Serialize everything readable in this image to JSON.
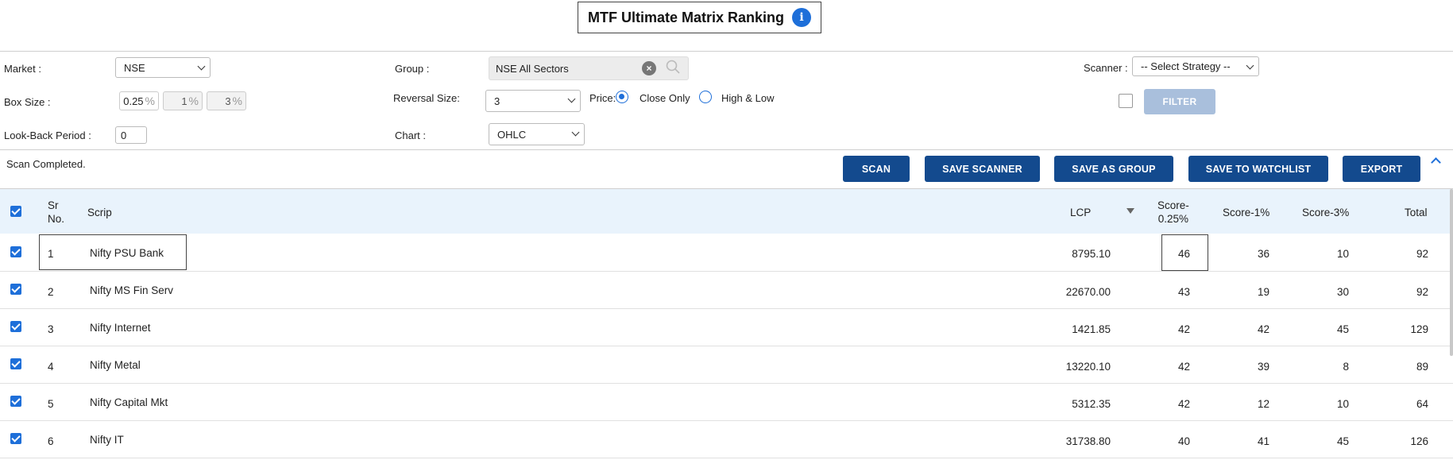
{
  "title": "MTF Ultimate Matrix Ranking",
  "info_icon_glyph": "i",
  "filters": {
    "market_label": "Market :",
    "market_value": "NSE",
    "box_size_label": "Box Size :",
    "box_sizes": [
      "0.25",
      "1",
      "3"
    ],
    "percent_sign": "%",
    "lookback_label": "Look-Back Period :",
    "lookback_value": "0",
    "group_label": "Group :",
    "group_value": "NSE All Sectors",
    "reversal_label": "Reversal Size:",
    "reversal_value": "3",
    "price_label": "Price:",
    "price_options": [
      "Close Only",
      "High & Low"
    ],
    "price_selected": "Close Only",
    "chart_label": "Chart :",
    "chart_value": "OHLC",
    "scanner_label": "Scanner :",
    "scanner_value": "-- Select Strategy --",
    "filter_label": "FILTER"
  },
  "actions": {
    "status": "Scan Completed.",
    "scan": "SCAN",
    "save_scanner": "SAVE SCANNER",
    "save_as_group": "SAVE AS GROUP",
    "save_to_watchlist": "SAVE TO WATCHLIST",
    "export": "EXPORT"
  },
  "table": {
    "headers": {
      "sr_no_1": "Sr",
      "sr_no_2": "No.",
      "scrip": "Scrip",
      "lcp": "LCP",
      "score025_1": "Score-",
      "score025_2": "0.25%",
      "score1": "Score-1%",
      "score3": "Score-3%",
      "total": "Total"
    },
    "rows": [
      {
        "sr": "1",
        "scrip": "Nifty PSU Bank",
        "lcp": "8795.10",
        "s025": "46",
        "s1": "36",
        "s3": "10",
        "total": "92"
      },
      {
        "sr": "2",
        "scrip": "Nifty MS Fin Serv",
        "lcp": "22670.00",
        "s025": "43",
        "s1": "19",
        "s3": "30",
        "total": "92"
      },
      {
        "sr": "3",
        "scrip": "Nifty Internet",
        "lcp": "1421.85",
        "s025": "42",
        "s1": "42",
        "s3": "45",
        "total": "129"
      },
      {
        "sr": "4",
        "scrip": "Nifty Metal",
        "lcp": "13220.10",
        "s025": "42",
        "s1": "39",
        "s3": "8",
        "total": "89"
      },
      {
        "sr": "5",
        "scrip": "Nifty Capital Mkt",
        "lcp": "5312.35",
        "s025": "42",
        "s1": "12",
        "s3": "10",
        "total": "64"
      },
      {
        "sr": "6",
        "scrip": "Nifty IT",
        "lcp": "31738.80",
        "s025": "40",
        "s1": "41",
        "s3": "45",
        "total": "126"
      }
    ]
  }
}
